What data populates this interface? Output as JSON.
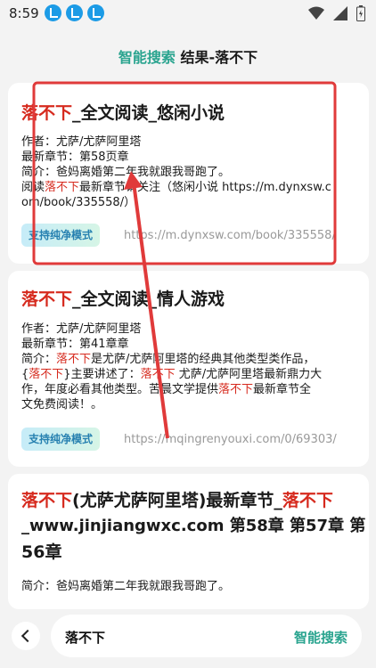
{
  "status": {
    "time": "8:59"
  },
  "header": {
    "accent": "智能搜索",
    "rest": " 结果-落不下"
  },
  "results": [
    {
      "title_red": "落不下",
      "title_rest": "_全文阅读_悠闲小说",
      "author": "作者：尤萨/尤萨阿里塔",
      "latest": "最新章节：第58页章",
      "intro": "简介：爸妈离婚第二年我就跟我哥跑了。",
      "extra1_pre": "阅读",
      "extra1_red": "落不下",
      "extra1_post": "最新章节请关注（悠闲小说 https://m.dynxsw.c",
      "extra2": "om/book/335558/）",
      "badge": "支持纯净模式",
      "url": "https://m.dynxsw.com/book/335558/"
    },
    {
      "title_red": "落不下",
      "title_rest": "_全文阅读_情人游戏",
      "author": "作者：尤萨/尤萨阿里塔",
      "latest": "最新章节：第41章章",
      "intro_pre": "简介：",
      "intro_red": "落不下",
      "intro_post": "是尤萨/尤萨阿里塔的经典其他类型类作品，",
      "line2_a": "{",
      "line2_b": "落不下",
      "line2_c": "}主要讲述了：",
      "line2_d": "落不下",
      "line2_e": " 尤萨/尤萨阿里塔最新鼎力大",
      "line3": "作，年度必看其他类型。苦晨文学提供",
      "line3_red": "落不下",
      "line3_post": "最新章节全",
      "line4": "文免费阅读！。",
      "badge": "支持纯净模式",
      "url": "https://mqingrenyouxi.com/0/69303/"
    },
    {
      "t1_red": "落不下",
      "t1_mid": "(尤萨尤萨阿里塔)最新章节_",
      "t1_red2": "落不下",
      "t2": "_www.jinjiangwxc.com  第58章  第57章  第",
      "t3": "56章",
      "intro": "简介：爸妈离婚第二年我就跟我哥跑了。"
    }
  ],
  "search": {
    "query": "落不下",
    "button": "智能搜索"
  },
  "colors": {
    "accent": "#2aa48f",
    "highlight": "#d62a1e",
    "annotation": "#e03a3a"
  },
  "icons": [
    "download-icon",
    "wifi-icon",
    "signal-icon",
    "battery-icon",
    "back-icon"
  ]
}
